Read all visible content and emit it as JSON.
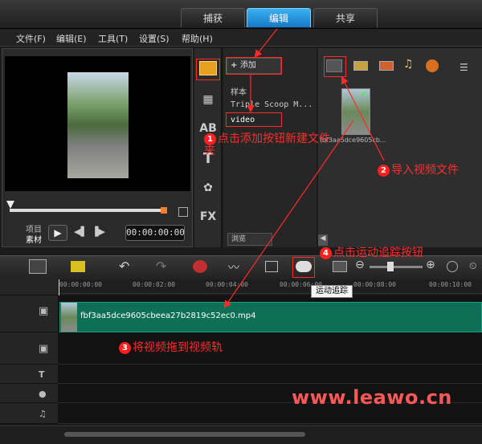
{
  "tabs": [
    {
      "label": "捕获"
    },
    {
      "label": "编辑"
    },
    {
      "label": "共享"
    }
  ],
  "menu": [
    "文件(F)",
    "编辑(E)",
    "工具(T)",
    "设置(S)",
    "帮助(H)"
  ],
  "preview": {
    "project_label": "项目",
    "clip_label": "素材",
    "timecode": "00:00:00:00"
  },
  "library": {
    "add_label": "添加",
    "folders": [
      "样本",
      "Triple Scoop M...",
      "video"
    ],
    "browse_label": "浏览",
    "thumb_name": "fbf3aa5dce9605cb...",
    "tool_labels": {
      "title": "T",
      "fx": "FX",
      "ab": "AB"
    }
  },
  "timeline": {
    "ticks": [
      "00:00:00:00",
      "00:00:02:00",
      "00:00:04:00",
      "00:00:06:00",
      "00:00:08:00",
      "00:00:10:00"
    ],
    "clip_name": "fbf3aa5dce9605cbeea27b2819c52ec0.mp4",
    "tooltip": "运动追踪"
  },
  "annotations": {
    "step1_num": "1",
    "step1": "点击添加按钮新建文件夹",
    "step2_num": "2",
    "step2": "导入视频文件",
    "step3_num": "3",
    "step3": "将视频拖到视频轨",
    "step4_num": "4",
    "step4": "点击运动追踪按钮"
  },
  "watermark": "www.leawo.cn",
  "colors": {
    "accent": "#1e90e0",
    "annotation": "#ff2a2a",
    "clip": "#0e6f57"
  }
}
